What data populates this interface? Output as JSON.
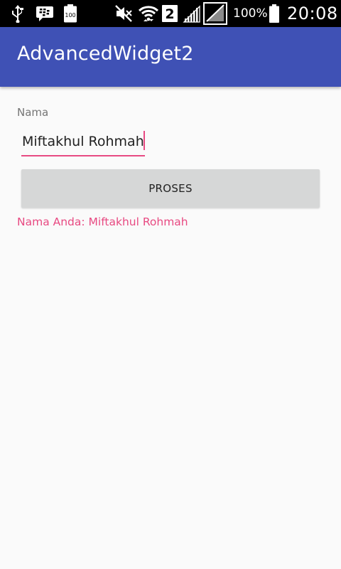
{
  "status_bar": {
    "icons": [
      "usb-icon",
      "bbm-icon",
      "battery-100-icon",
      "mute-icon",
      "wifi-icon",
      "sim-2-icon",
      "signal-icon",
      "signal-no-sim-icon",
      "battery-icon"
    ],
    "sim_label": "2",
    "small_battery_label": "100",
    "battery_percent": "100%",
    "time": "20:08"
  },
  "app_bar": {
    "title": "AdvancedWidget2",
    "color": "#3f51b5"
  },
  "form": {
    "name_label": "Nama",
    "name_value": "Miftakhul Rohmah",
    "accent_color": "#e84a82",
    "button_label": "PROSES",
    "result_text": "Nama Anda: Miftakhul Rohmah"
  }
}
